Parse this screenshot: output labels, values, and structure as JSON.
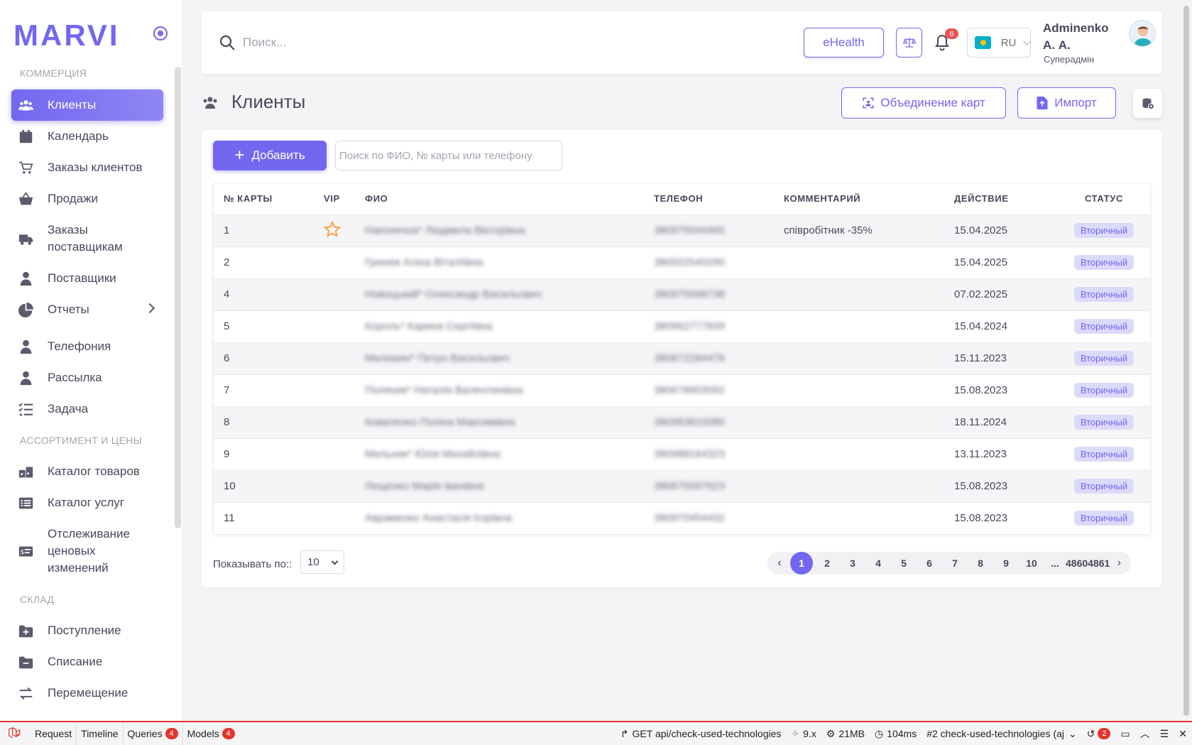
{
  "brand": {
    "logo": "MARVI"
  },
  "sidebar": {
    "sections": [
      {
        "header": "Коммерция"
      },
      {
        "header": "Ассортимент и цены"
      },
      {
        "header": "Склад"
      }
    ],
    "items": [
      {
        "label": "Клиенты",
        "icon": "users-icon",
        "active": true
      },
      {
        "label": "Календарь",
        "icon": "calendar-icon"
      },
      {
        "label": "Заказы клиентов",
        "icon": "cart-icon"
      },
      {
        "label": "Продажи",
        "icon": "basket-icon"
      },
      {
        "label": "Заказы поставщикам",
        "icon": "truck-icon"
      },
      {
        "label": "Поставщики",
        "icon": "user-icon"
      },
      {
        "label": "Отчеты",
        "icon": "pie-chart-icon"
      },
      {
        "label": "Телефония",
        "icon": "user-icon"
      },
      {
        "label": "Рассылка",
        "icon": "user-icon"
      },
      {
        "label": "Задача",
        "icon": "checklist-icon"
      },
      {
        "label": "Каталог товаров",
        "icon": "boxes-icon"
      },
      {
        "label": "Каталог услуг",
        "icon": "list-icon"
      },
      {
        "label": "Отслеживание ценовых изменений",
        "icon": "price-tag-icon"
      },
      {
        "label": "Поступление",
        "icon": "folder-plus-icon"
      },
      {
        "label": "Списание",
        "icon": "folder-minus-icon"
      },
      {
        "label": "Перемещение",
        "icon": "transfer-icon"
      }
    ]
  },
  "topbar": {
    "search_placeholder": "Поиск...",
    "ehealth_label": "eHealth",
    "notifications_count": "6",
    "language": "RU",
    "user_name": "Adminenko А. А.",
    "user_role": "Суперадмін"
  },
  "page": {
    "title": "Клиенты",
    "merge_button": "Объединение карт",
    "import_button": "Импорт",
    "add_button": "Добавить",
    "filter_placeholder": "Поиск по ФИО, № карты или телефону"
  },
  "table": {
    "headers": [
      "№ карты",
      "VIP",
      "ФИО",
      "Телефон",
      "Комментарий",
      "Действие",
      "Статус"
    ],
    "rows": [
      {
        "card": "1",
        "vip": true,
        "name": "Наконечна* Людмила Вікторівна",
        "phone": "380975044465",
        "comment": "співробітник -35%",
        "date": "15.04.2025",
        "status": "Вторичный"
      },
      {
        "card": "2",
        "vip": false,
        "name": "Гринюк Аліна Віталіївна",
        "phone": "380502540290",
        "comment": "",
        "date": "15.04.2025",
        "status": "Вторичный"
      },
      {
        "card": "4",
        "vip": false,
        "name": "Новоцький* Олександр Васильович",
        "phone": "380975098738",
        "comment": "",
        "date": "07.02.2025",
        "status": "Вторичный"
      },
      {
        "card": "5",
        "vip": false,
        "name": "Король* Карина Сергіївна",
        "phone": "380962777839",
        "comment": "",
        "date": "15.04.2024",
        "status": "Вторичный"
      },
      {
        "card": "6",
        "vip": false,
        "name": "Милюкин* Петро Васильович",
        "phone": "380672284476",
        "comment": "",
        "date": "15.11.2023",
        "status": "Вторичный"
      },
      {
        "card": "7",
        "vip": false,
        "name": "Поляник* Наталія Валентинівна",
        "phone": "380678903092",
        "comment": "",
        "date": "15.08.2023",
        "status": "Вторичный"
      },
      {
        "card": "8",
        "vip": false,
        "name": "Коваленко Поліна Максимівна",
        "phone": "380983810080",
        "comment": "",
        "date": "18.11.2024",
        "status": "Вторичный"
      },
      {
        "card": "9",
        "vip": false,
        "name": "Мельник* Юлія Михайлівна",
        "phone": "380988164323",
        "comment": "",
        "date": "13.11.2023",
        "status": "Вторичный"
      },
      {
        "card": "10",
        "vip": false,
        "name": "Лещенко Марія Іванівна",
        "phone": "380675597623",
        "comment": "",
        "date": "15.08.2023",
        "status": "Вторичный"
      },
      {
        "card": "11",
        "vip": false,
        "name": "Авраменко Анастасія Ігорівна",
        "phone": "380970454432",
        "comment": "",
        "date": "15.08.2023",
        "status": "Вторичный"
      }
    ]
  },
  "pagination": {
    "show_label": "Показывать по::",
    "page_size": "10",
    "pages": [
      "1",
      "2",
      "3",
      "4",
      "5",
      "6",
      "7",
      "8",
      "9",
      "10",
      "...",
      "4860",
      "4861"
    ],
    "current": "1",
    "prev": "‹",
    "next": "›"
  },
  "debugbar": {
    "tabs": [
      {
        "label": "Request"
      },
      {
        "label": "Timeline"
      },
      {
        "label": "Queries",
        "badge": "4"
      },
      {
        "label": "Models",
        "badge": "4"
      }
    ],
    "request": "GET api/check-used-technologies",
    "version": "9.x",
    "memory": "21MB",
    "time": "104ms",
    "request_select": "#2 check-used-technologies (aj",
    "history_count": "2"
  }
}
